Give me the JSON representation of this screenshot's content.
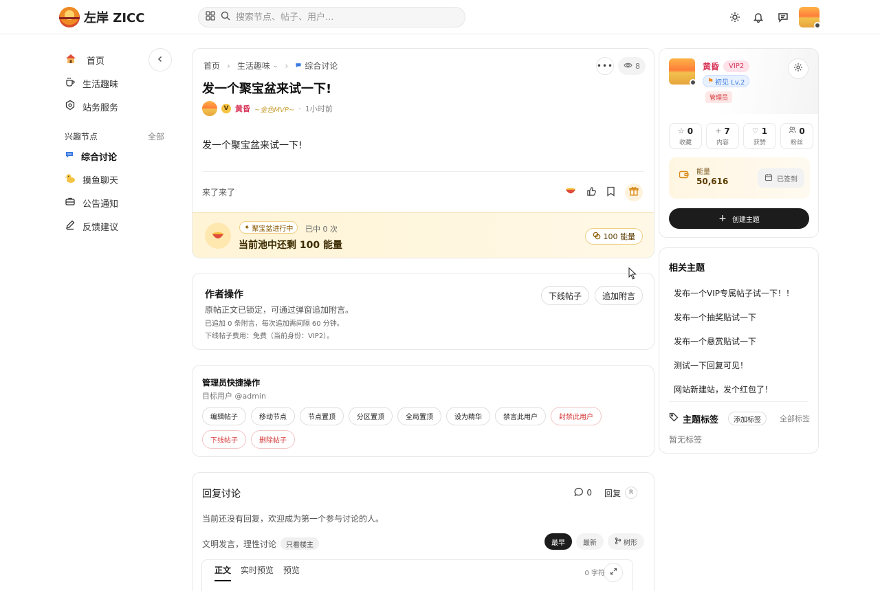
{
  "header": {
    "site_name": "左岸 ZICC",
    "search_placeholder": "搜索节点、帖子、用户..."
  },
  "sidebar": {
    "nav": [
      {
        "label": "首页",
        "icon": "house-icon"
      },
      {
        "label": "生活趣味",
        "icon": "coffee-icon"
      },
      {
        "label": "站务服务",
        "icon": "service-icon"
      }
    ],
    "section_title": "兴趣节点",
    "section_all": "全部",
    "nodes": [
      {
        "label": "综合讨论",
        "icon": "chat-bubble-icon",
        "active": true
      },
      {
        "label": "摸鱼聊天",
        "icon": "duck-icon"
      },
      {
        "label": "公告通知",
        "icon": "toolbox-icon"
      },
      {
        "label": "反馈建议",
        "icon": "pencil-icon"
      }
    ]
  },
  "post": {
    "breadcrumb": [
      "首页",
      "生活趣味",
      "综合讨论"
    ],
    "views": "8",
    "title": "发一个聚宝盆来试一下!",
    "author": "黄昏",
    "author_badge": "V",
    "mvp_label": "~金色MVP~",
    "time": "1小时前",
    "meta_dot": "·",
    "body": "发一个聚宝盆来试一下!",
    "signature": "来了来了",
    "pot": {
      "status": "聚宝盆进行中",
      "hits": "已中 0 次",
      "title": "当前池中还剩 100 能量",
      "energy_button": "100 能量"
    }
  },
  "author_ops": {
    "title": "作者操作",
    "line1": "原帖正文已锁定，可通过弹窗追加附言。",
    "line2": "已追加 0 条附言，每次追加需间隔 60 分钟。",
    "line3": "下线帖子费用：免费（当前身份：VIP2）。",
    "offline_button": "下线帖子",
    "append_button": "追加附言"
  },
  "admin_ops": {
    "title": "管理员快捷操作",
    "target": "目标用户 @admin",
    "buttons": [
      {
        "label": "编辑帖子",
        "danger": false
      },
      {
        "label": "移动节点",
        "danger": false
      },
      {
        "label": "节点置顶",
        "danger": false
      },
      {
        "label": "分区置顶",
        "danger": false
      },
      {
        "label": "全局置顶",
        "danger": false
      },
      {
        "label": "设为精华",
        "danger": false
      },
      {
        "label": "禁言此用户",
        "danger": false
      },
      {
        "label": "封禁此用户",
        "danger": true
      },
      {
        "label": "下线帖子",
        "danger": true
      },
      {
        "label": "删除帖子",
        "danger": true
      }
    ]
  },
  "replies": {
    "title": "回复讨论",
    "count": "0",
    "reply_label": "回复",
    "reply_shortcut": "R",
    "empty": "当前还没有回复，欢迎成为第一个参与讨论的人。",
    "rule": "文明发言，理性讨论",
    "only_op": "只看楼主",
    "sort": [
      "最早",
      "最新",
      "树形"
    ],
    "editor_tabs": [
      "正文",
      "实时预览",
      "预览"
    ],
    "char_count": "0 字符"
  },
  "profile": {
    "name": "黄昏",
    "vip": "VIP2",
    "level": "初见 Lv.2",
    "role": "管理员",
    "stats": [
      {
        "value": "0",
        "label": "收藏",
        "icon": "star-icon"
      },
      {
        "value": "7",
        "label": "内容",
        "icon": "plus-icon"
      },
      {
        "value": "1",
        "label": "获赞",
        "icon": "heart-icon"
      },
      {
        "value": "0",
        "label": "粉丝",
        "icon": "users-icon"
      }
    ],
    "energy_label": "能量",
    "energy_value": "50,616",
    "checked_in": "已签到",
    "create_button": "创建主题"
  },
  "related": {
    "title": "相关主题",
    "items": [
      "发布一个VIP专属帖子试一下！！",
      "发布一个抽奖贴试一下",
      "发布一个悬赏贴试一下",
      "测试一下回复可见！",
      "网站新建站，发个红包了！"
    ],
    "tags_title": "主题标签",
    "add_tag": "添加标签",
    "all_tags": "全部标签",
    "no_tags": "暂无标签"
  },
  "colors": {
    "accent_name": "#d9365a",
    "pot_bg": "#fff4d6",
    "primary_button": "#1c1c1c"
  }
}
